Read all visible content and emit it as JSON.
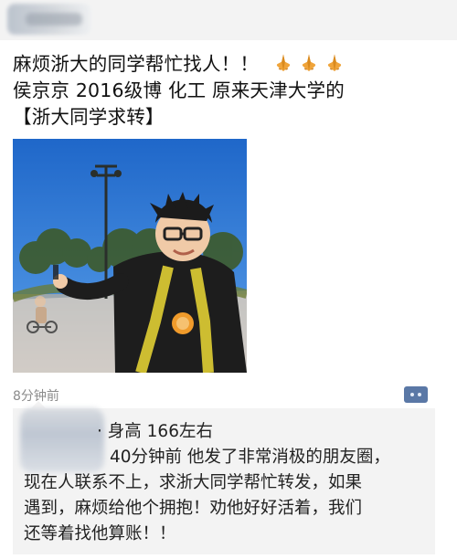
{
  "post": {
    "line1": "麻烦浙大的同学帮忙找人！！",
    "line2": "侯京京 2016级博 化工 原来天津大学的",
    "line3": "【浙大同学求转】",
    "emoji": [
      "pray-icon",
      "pray-icon",
      "pray-icon"
    ]
  },
  "moment": {
    "time": "8分钟前"
  },
  "comment": {
    "line1": "身高 166左右",
    "line2": "40分钟前 他发了非常消极的朋友圈，",
    "line3": "现在人联系不上，求浙大同学帮忙转发，如果",
    "line4": "遇到，麻烦给他个拥抱！劝他好好活着，我们",
    "line5": "还等着找他算账！！"
  }
}
